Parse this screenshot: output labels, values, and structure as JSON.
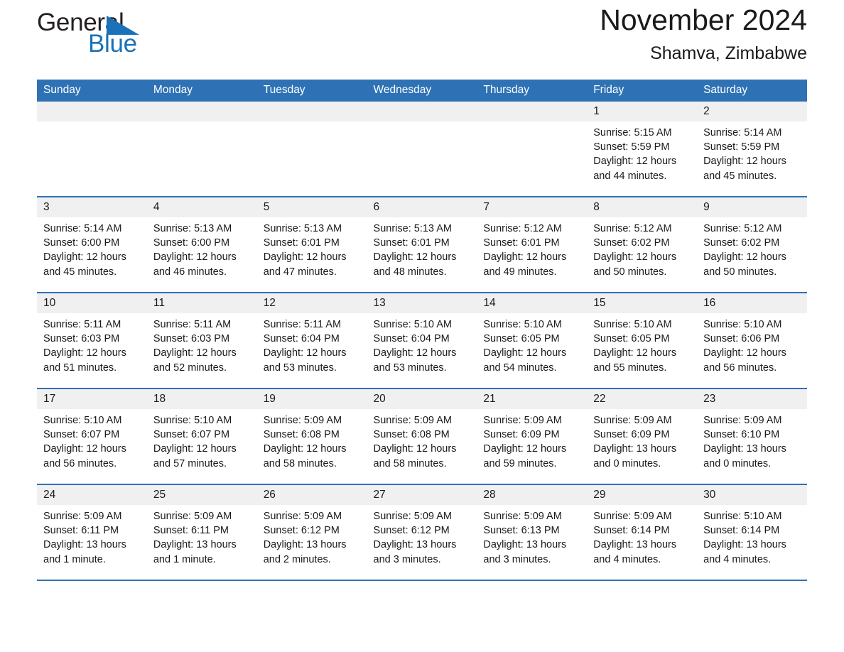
{
  "logo": {
    "word_one": "General",
    "word_two": "Blue",
    "accent_color": "#1a72b8"
  },
  "header": {
    "title": "November 2024",
    "location": "Shamva, Zimbabwe",
    "header_bg_color": "#2e72b5",
    "daynum_bg_color": "#f0f0f0"
  },
  "weekday_headers": [
    "Sunday",
    "Monday",
    "Tuesday",
    "Wednesday",
    "Thursday",
    "Friday",
    "Saturday"
  ],
  "weeks": [
    [
      {
        "day": "",
        "sunrise": "",
        "sunset": "",
        "daylight": ""
      },
      {
        "day": "",
        "sunrise": "",
        "sunset": "",
        "daylight": ""
      },
      {
        "day": "",
        "sunrise": "",
        "sunset": "",
        "daylight": ""
      },
      {
        "day": "",
        "sunrise": "",
        "sunset": "",
        "daylight": ""
      },
      {
        "day": "",
        "sunrise": "",
        "sunset": "",
        "daylight": ""
      },
      {
        "day": "1",
        "sunrise": "Sunrise: 5:15 AM",
        "sunset": "Sunset: 5:59 PM",
        "daylight": "Daylight: 12 hours and 44 minutes."
      },
      {
        "day": "2",
        "sunrise": "Sunrise: 5:14 AM",
        "sunset": "Sunset: 5:59 PM",
        "daylight": "Daylight: 12 hours and 45 minutes."
      }
    ],
    [
      {
        "day": "3",
        "sunrise": "Sunrise: 5:14 AM",
        "sunset": "Sunset: 6:00 PM",
        "daylight": "Daylight: 12 hours and 45 minutes."
      },
      {
        "day": "4",
        "sunrise": "Sunrise: 5:13 AM",
        "sunset": "Sunset: 6:00 PM",
        "daylight": "Daylight: 12 hours and 46 minutes."
      },
      {
        "day": "5",
        "sunrise": "Sunrise: 5:13 AM",
        "sunset": "Sunset: 6:01 PM",
        "daylight": "Daylight: 12 hours and 47 minutes."
      },
      {
        "day": "6",
        "sunrise": "Sunrise: 5:13 AM",
        "sunset": "Sunset: 6:01 PM",
        "daylight": "Daylight: 12 hours and 48 minutes."
      },
      {
        "day": "7",
        "sunrise": "Sunrise: 5:12 AM",
        "sunset": "Sunset: 6:01 PM",
        "daylight": "Daylight: 12 hours and 49 minutes."
      },
      {
        "day": "8",
        "sunrise": "Sunrise: 5:12 AM",
        "sunset": "Sunset: 6:02 PM",
        "daylight": "Daylight: 12 hours and 50 minutes."
      },
      {
        "day": "9",
        "sunrise": "Sunrise: 5:12 AM",
        "sunset": "Sunset: 6:02 PM",
        "daylight": "Daylight: 12 hours and 50 minutes."
      }
    ],
    [
      {
        "day": "10",
        "sunrise": "Sunrise: 5:11 AM",
        "sunset": "Sunset: 6:03 PM",
        "daylight": "Daylight: 12 hours and 51 minutes."
      },
      {
        "day": "11",
        "sunrise": "Sunrise: 5:11 AM",
        "sunset": "Sunset: 6:03 PM",
        "daylight": "Daylight: 12 hours and 52 minutes."
      },
      {
        "day": "12",
        "sunrise": "Sunrise: 5:11 AM",
        "sunset": "Sunset: 6:04 PM",
        "daylight": "Daylight: 12 hours and 53 minutes."
      },
      {
        "day": "13",
        "sunrise": "Sunrise: 5:10 AM",
        "sunset": "Sunset: 6:04 PM",
        "daylight": "Daylight: 12 hours and 53 minutes."
      },
      {
        "day": "14",
        "sunrise": "Sunrise: 5:10 AM",
        "sunset": "Sunset: 6:05 PM",
        "daylight": "Daylight: 12 hours and 54 minutes."
      },
      {
        "day": "15",
        "sunrise": "Sunrise: 5:10 AM",
        "sunset": "Sunset: 6:05 PM",
        "daylight": "Daylight: 12 hours and 55 minutes."
      },
      {
        "day": "16",
        "sunrise": "Sunrise: 5:10 AM",
        "sunset": "Sunset: 6:06 PM",
        "daylight": "Daylight: 12 hours and 56 minutes."
      }
    ],
    [
      {
        "day": "17",
        "sunrise": "Sunrise: 5:10 AM",
        "sunset": "Sunset: 6:07 PM",
        "daylight": "Daylight: 12 hours and 56 minutes."
      },
      {
        "day": "18",
        "sunrise": "Sunrise: 5:10 AM",
        "sunset": "Sunset: 6:07 PM",
        "daylight": "Daylight: 12 hours and 57 minutes."
      },
      {
        "day": "19",
        "sunrise": "Sunrise: 5:09 AM",
        "sunset": "Sunset: 6:08 PM",
        "daylight": "Daylight: 12 hours and 58 minutes."
      },
      {
        "day": "20",
        "sunrise": "Sunrise: 5:09 AM",
        "sunset": "Sunset: 6:08 PM",
        "daylight": "Daylight: 12 hours and 58 minutes."
      },
      {
        "day": "21",
        "sunrise": "Sunrise: 5:09 AM",
        "sunset": "Sunset: 6:09 PM",
        "daylight": "Daylight: 12 hours and 59 minutes."
      },
      {
        "day": "22",
        "sunrise": "Sunrise: 5:09 AM",
        "sunset": "Sunset: 6:09 PM",
        "daylight": "Daylight: 13 hours and 0 minutes."
      },
      {
        "day": "23",
        "sunrise": "Sunrise: 5:09 AM",
        "sunset": "Sunset: 6:10 PM",
        "daylight": "Daylight: 13 hours and 0 minutes."
      }
    ],
    [
      {
        "day": "24",
        "sunrise": "Sunrise: 5:09 AM",
        "sunset": "Sunset: 6:11 PM",
        "daylight": "Daylight: 13 hours and 1 minute."
      },
      {
        "day": "25",
        "sunrise": "Sunrise: 5:09 AM",
        "sunset": "Sunset: 6:11 PM",
        "daylight": "Daylight: 13 hours and 1 minute."
      },
      {
        "day": "26",
        "sunrise": "Sunrise: 5:09 AM",
        "sunset": "Sunset: 6:12 PM",
        "daylight": "Daylight: 13 hours and 2 minutes."
      },
      {
        "day": "27",
        "sunrise": "Sunrise: 5:09 AM",
        "sunset": "Sunset: 6:12 PM",
        "daylight": "Daylight: 13 hours and 3 minutes."
      },
      {
        "day": "28",
        "sunrise": "Sunrise: 5:09 AM",
        "sunset": "Sunset: 6:13 PM",
        "daylight": "Daylight: 13 hours and 3 minutes."
      },
      {
        "day": "29",
        "sunrise": "Sunrise: 5:09 AM",
        "sunset": "Sunset: 6:14 PM",
        "daylight": "Daylight: 13 hours and 4 minutes."
      },
      {
        "day": "30",
        "sunrise": "Sunrise: 5:10 AM",
        "sunset": "Sunset: 6:14 PM",
        "daylight": "Daylight: 13 hours and 4 minutes."
      }
    ]
  ]
}
